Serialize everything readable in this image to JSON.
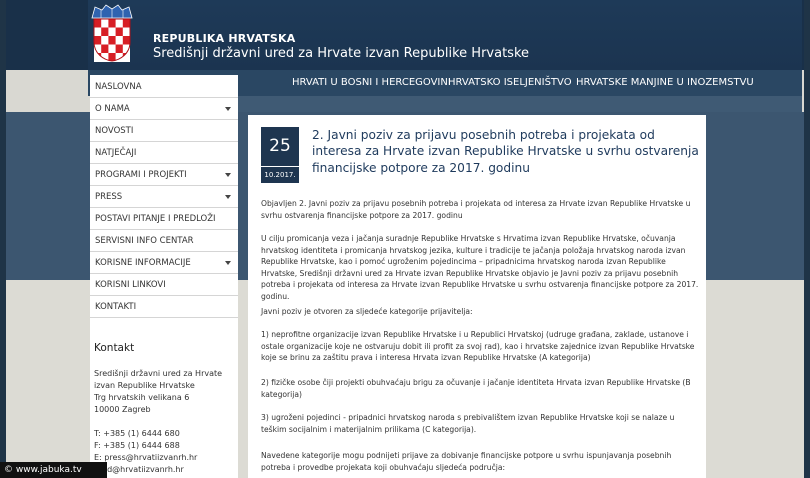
{
  "header": {
    "title": "REPUBLIKA HRVATSKA",
    "subtitle": "Središnji državni ured za Hrvate izvan Republike Hrvatske"
  },
  "topnav": {
    "items": [
      {
        "label": "HRVATI U BOSNI I HERCEGOVINI"
      },
      {
        "label": "HRVATSKO ISELJENIŠTVO"
      },
      {
        "label": "HRVATSKE MANJINE U INOZEMSTVU"
      }
    ]
  },
  "sidebar": {
    "items": [
      {
        "label": "NASLOVNA",
        "has_dropdown": false
      },
      {
        "label": "O NAMA",
        "has_dropdown": true
      },
      {
        "label": "NOVOSTI",
        "has_dropdown": false
      },
      {
        "label": "NATJEČAJI",
        "has_dropdown": false
      },
      {
        "label": "PROGRAMI I PROJEKTI",
        "has_dropdown": true
      },
      {
        "label": "PRESS",
        "has_dropdown": true
      },
      {
        "label": "POSTAVI PITANJE I PREDLOŽI",
        "has_dropdown": false
      },
      {
        "label": "SERVISNI INFO CENTAR",
        "has_dropdown": false
      },
      {
        "label": "KORISNE INFORMACIJE",
        "has_dropdown": true
      },
      {
        "label": "KORISNI LINKOVI",
        "has_dropdown": false
      },
      {
        "label": "KONTAKTI",
        "has_dropdown": false
      }
    ]
  },
  "contact": {
    "title": "Kontakt",
    "lines": [
      "Središnji državni ured za Hrvate",
      "izvan Republike Hrvatske",
      "Trg hrvatskih velikana 6",
      "10000 Zagreb",
      "T: +385 (1) 6444 680",
      "F: +385 (1) 6444 688",
      "E: press@hrvatiizvanrh.hr",
      "ured@hrvatiizvanrh.hr"
    ]
  },
  "article": {
    "day": "25",
    "month_year": "10.2017.",
    "title": "2. Javni poziv za prijavu posebnih potreba i projekata od interesa za Hrvate izvan Republike Hrvatske u svrhu ostvarenja financijske potpore za 2017. godinu",
    "paragraphs": [
      "Objavljen 2. Javni poziv za prijavu posebnih potreba i projekata od interesa za Hrvate izvan Republike Hrvatske u svrhu ostvarenja financijske potpore za 2017. godinu",
      "U cilju promicanja veza i jačanja suradnje Republike Hrvatske s Hrvatima izvan Republike Hrvatske, očuvanja hrvatskog identiteta i promicanja hrvatskog jezika, kulture i tradicije te jačanja položaja hrvatskog naroda izvan Republike Hrvatske, kao i pomoć ugroženim pojedincima – pripadnicima hrvatskog naroda izvan Republike Hrvatske, Središnji državni ured za Hrvate izvan Republike Hrvatske objavio je Javni poziv za prijavu posebnih potreba i projekata od interesa za Hrvate izvan Republike Hrvatske u svrhu ostvarenja financijske potpore za 2017. godinu.",
      "Javni poziv je otvoren za sljedeće kategorije prijavitelja:",
      "1) neprofitne organizacije izvan Republike Hrvatske i u Republici Hrvatskoj (udruge građana, zaklade, ustanove i ostale organizacije koje ne ostvaruju dobit ili profit za svoj rad), kao i hrvatske zajednice izvan Republike Hrvatske koje se brinu za zaštitu prava i interesa Hrvata izvan Republike Hrvatske (A kategorija)",
      "2) fizičke osobe čiji projekti obuhvaćaju brigu za očuvanje i jačanje identiteta Hrvata izvan Republike Hrvatske (B kategorija)",
      "3) ugroženi pojedinci - pripadnici hrvatskog naroda s prebivalištem izvan Republike Hrvatske koji se nalaze u teškim socijalnim i materijalnim prilikama (C kategorija).",
      "Navedene kategorije mogu podnijeti prijave za dobivanje financijske potpore u svrhu ispunjavanja posebnih potreba i provedbe projekata koji obuhvaćaju sljedeća područja:"
    ]
  },
  "watermark": "© www.jabuka.tv",
  "colors": {
    "header_bg": "#1b3450",
    "nav_bg": "#2a4763",
    "date_box": "#1e3550",
    "title_text": "#1e3a5c"
  }
}
